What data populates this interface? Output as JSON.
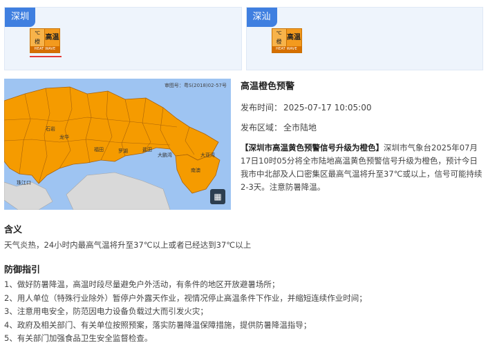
{
  "regions": [
    {
      "name": "深圳",
      "active": true,
      "icon": "heat-wave-orange-warning-icon",
      "icon_text": {
        "level": "橙",
        "chars": "高温",
        "eng": "HEAT WAVE",
        "unit": "℃"
      }
    },
    {
      "name": "深汕",
      "active": false,
      "icon": "heat-wave-orange-warning-icon",
      "icon_text": {
        "level": "橙",
        "chars": "高温",
        "eng": "HEAT WAVE",
        "unit": "℃"
      }
    }
  ],
  "map": {
    "approval_code": "审图号：粤S(2018)02-57号",
    "labels": [
      "福田",
      "罗湖",
      "盐田",
      "大鹏湾",
      "大亚湾",
      "南澳",
      "珠江口",
      "石岩",
      "龙华"
    ],
    "land_color": "#f59b00",
    "water_color": "#9ec4f2",
    "land_outline": "#a8620a",
    "expand_icon": "grid-expand-icon"
  },
  "warning": {
    "title": "高温橙色预警",
    "publish_label": "发布时间：",
    "publish_time": "2025-07-17 10:05:00",
    "area_label": "发布区域：",
    "area": "全市陆地",
    "headline": "【深圳市高温黄色预警信号升级为橙色】",
    "body": "深圳市气象台2025年07月17日10时05分将全市陆地高温黄色预警信号升级为橙色，预计今日我市中北部及人口密集区最高气温将升至37℃或以上，信号可能持续2-3天。注意防暑降温。"
  },
  "meaning": {
    "title": "含义",
    "text": "天气炎热，24小时内最高气温将升至37℃以上或者已经达到37℃以上"
  },
  "guidance": {
    "title": "防御指引",
    "items": [
      "1、做好防暑降温，高温时段尽量避免户外活动，有条件的地区开放避暑场所；",
      "2、用人单位（特殊行业除外）暂停户外露天作业，视情况停止高温条件下作业，并缩短连续作业时间；",
      "3、注意用电安全，防范因电力设备负载过大而引发火灾；",
      "4、政府及相关部门、有关单位按照预案，落实防暑降温保障措施，提供防暑降温指导；",
      "5、有关部门加强食品卫生安全监督检查。"
    ]
  }
}
